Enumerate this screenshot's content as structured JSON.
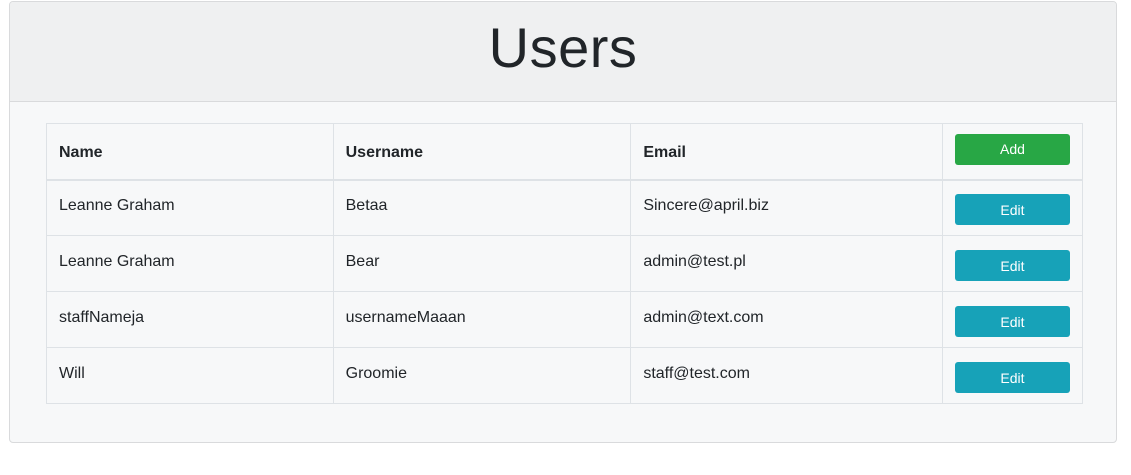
{
  "header": {
    "title": "Users"
  },
  "table": {
    "columns": [
      "Name",
      "Username",
      "Email"
    ],
    "add_label": "Add",
    "edit_label": "Edit",
    "rows": [
      {
        "name": "Leanne Graham",
        "username": "Betaa",
        "email": "Sincere@april.biz"
      },
      {
        "name": "Leanne Graham",
        "username": "Bear",
        "email": "admin@test.pl"
      },
      {
        "name": "staffNameja",
        "username": "usernameMaaan",
        "email": "admin@text.com"
      },
      {
        "name": "Will",
        "username": "Groomie",
        "email": "staff@test.com"
      }
    ]
  },
  "colors": {
    "add_button": "#28a745",
    "edit_button": "#17a2b8",
    "header_bg": "#eff0f1",
    "card_bg": "#f7f8f9"
  }
}
